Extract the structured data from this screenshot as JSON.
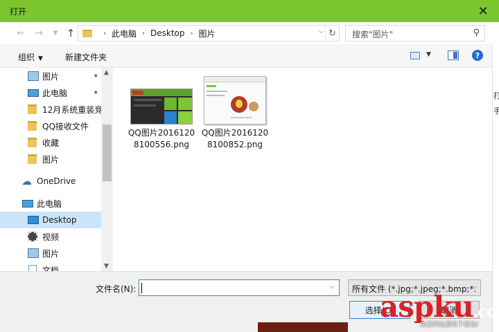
{
  "window": {
    "title": "打开"
  },
  "address": {
    "crumbs": [
      "此电脑",
      "Desktop",
      "图片"
    ]
  },
  "search": {
    "placeholder": "搜索\"图片\""
  },
  "toolbar": {
    "organize": "组织",
    "new_folder": "新建文件夹"
  },
  "sidebar": {
    "items": [
      {
        "label": "图片",
        "icon": "pictures-icon",
        "pinned": true
      },
      {
        "label": "此电脑",
        "icon": "computer-icon",
        "pinned": true
      },
      {
        "label": "12月系统重装竞",
        "icon": "folder-icon"
      },
      {
        "label": "QQ接收文件",
        "icon": "folder-icon"
      },
      {
        "label": "收藏",
        "icon": "folder-icon"
      },
      {
        "label": "图片",
        "icon": "folder-icon"
      },
      {
        "label": "OneDrive",
        "icon": "cloud-icon"
      },
      {
        "label": "此电脑",
        "icon": "computer-icon"
      },
      {
        "label": "Desktop",
        "icon": "desktop-icon",
        "selected": true
      },
      {
        "label": "视频",
        "icon": "video-icon"
      },
      {
        "label": "图片",
        "icon": "pictures-icon"
      },
      {
        "label": "文档",
        "icon": "document-icon"
      }
    ]
  },
  "files": [
    {
      "name": "QQ图片20161208100556.png"
    },
    {
      "name": "QQ图片20161208100852.png"
    }
  ],
  "right_strip": [
    "打",
    "手"
  ],
  "bottom": {
    "filename_label": "文件名(N):",
    "filename_value": "",
    "filetype": "所有文件 (*.jpg;*.jpeg;*.bmp;*.",
    "open_button": "选择(O)",
    "cancel_button": "取消"
  },
  "watermark": {
    "brand": "aspku",
    "tld": ".com",
    "tagline": "免费网站源码下载站!"
  },
  "colors": {
    "titlebar": "#7bc62f",
    "selection": "#cce4f7",
    "accent": "#3c7fd1",
    "watermark": "#d6232a"
  }
}
